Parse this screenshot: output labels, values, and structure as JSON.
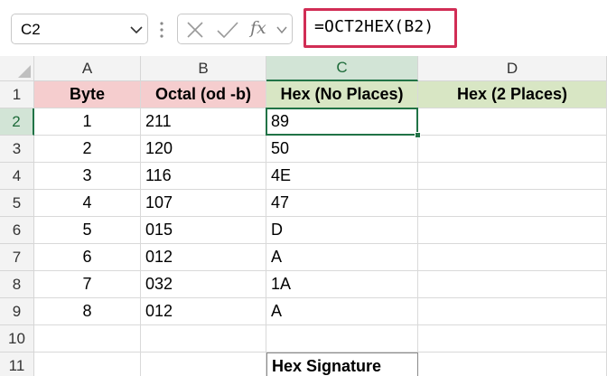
{
  "name_box": {
    "value": "C2"
  },
  "formula_bar": {
    "fx_label": "fx",
    "formula": "=OCT2HEX(B2)"
  },
  "columns": [
    "A",
    "B",
    "C",
    "D"
  ],
  "selected_column": "C",
  "rows": [
    "1",
    "2",
    "3",
    "4",
    "5",
    "6",
    "7",
    "8",
    "9",
    "10",
    "11"
  ],
  "selected_row": "2",
  "table": {
    "headers": [
      "Byte",
      "Octal (od -b)",
      "Hex (No Places)",
      "Hex (2 Places)"
    ],
    "rows": [
      [
        "1",
        "211",
        "89",
        ""
      ],
      [
        "2",
        "120",
        "50",
        ""
      ],
      [
        "3",
        "116",
        "4E",
        ""
      ],
      [
        "4",
        "107",
        "47",
        ""
      ],
      [
        "5",
        "015",
        "D",
        ""
      ],
      [
        "6",
        "012",
        "A",
        ""
      ],
      [
        "7",
        "032",
        "1A",
        ""
      ],
      [
        "8",
        "012",
        "A",
        ""
      ]
    ]
  },
  "signature_label": "Hex Signature",
  "colors": {
    "header_pink": "#f5cdce",
    "header_green": "#d8e6c4",
    "selection_green": "#217346",
    "formula_highlight": "#d12d55"
  }
}
